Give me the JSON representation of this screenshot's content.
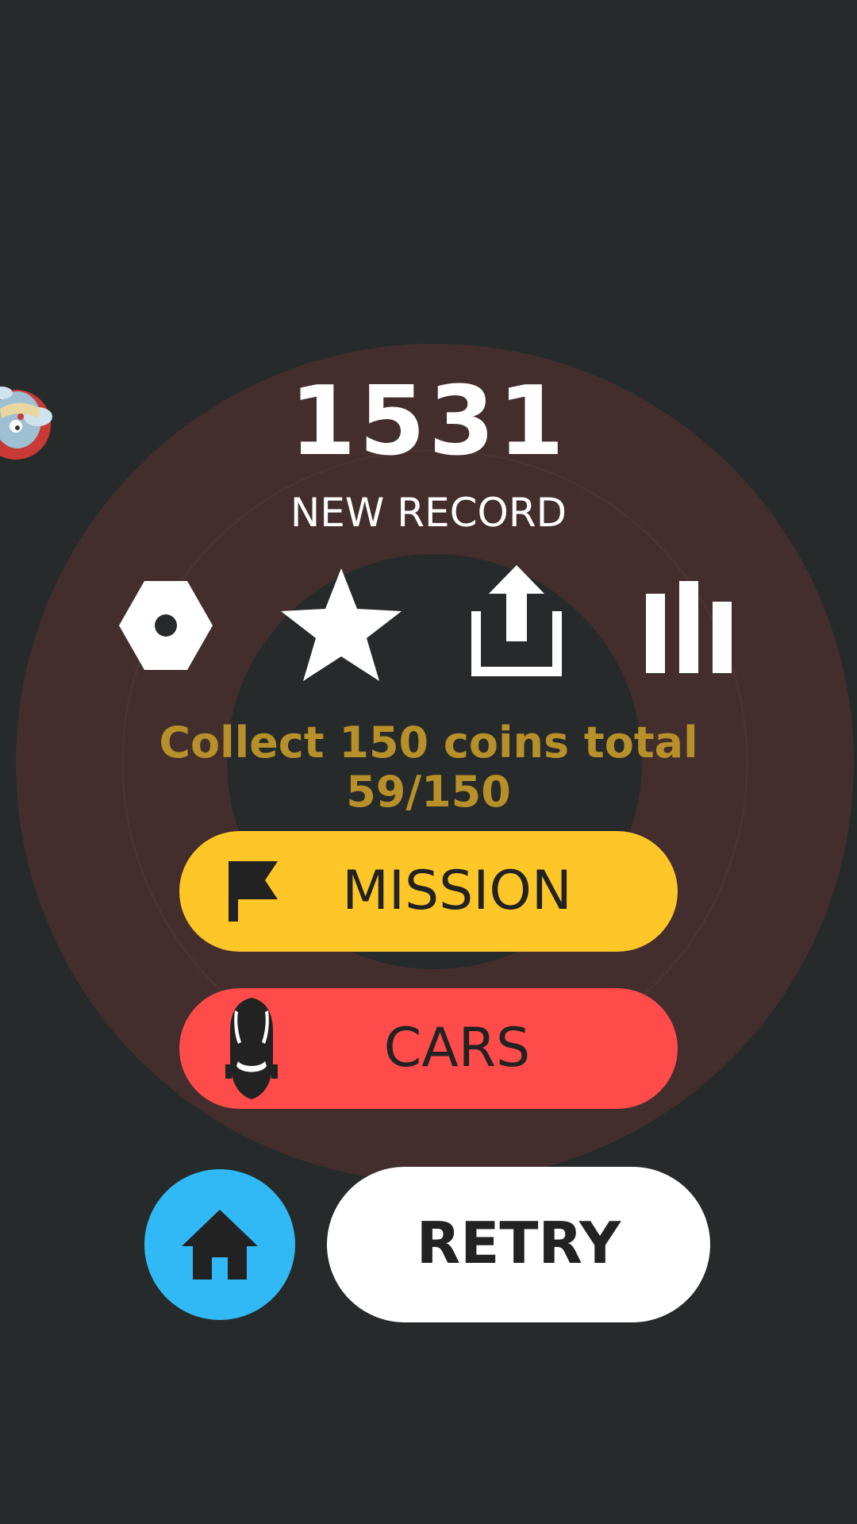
{
  "score": "1531",
  "score_subtitle": "NEW RECORD",
  "top_icons": [
    "gear-icon",
    "star-icon",
    "share-icon",
    "leaderboard-icon"
  ],
  "mission": {
    "description": "Collect 150 coins total",
    "progress_text": "59/150",
    "progress_current": 59,
    "progress_total": 150
  },
  "buttons": {
    "mission_label": "MISSION",
    "cars_label": "CARS",
    "retry_label": "RETRY"
  },
  "colors": {
    "background": "#262a2b",
    "ring": "#432e2d",
    "mission_button": "#fec727",
    "cars_button": "#ff4c4b",
    "home_button": "#31b9f5",
    "retry_button": "#ffffff",
    "mission_text": "#b79029"
  }
}
